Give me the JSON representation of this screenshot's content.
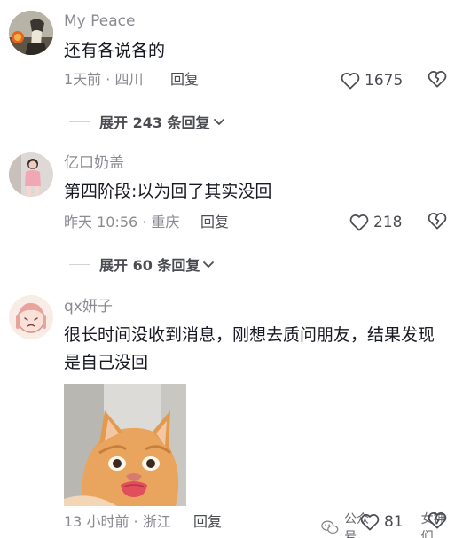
{
  "comments": [
    {
      "username": "My Peace",
      "text": "还有各说各的",
      "meta": "1天前 · 四川",
      "reply_label": "回复",
      "likes": "1675",
      "expand_label": "展开 243 条回复"
    },
    {
      "username": "亿口奶盖",
      "text": "第四阶段:以为回了其实没回",
      "meta": "昨天 10:56 · 重庆",
      "reply_label": "回复",
      "likes": "218",
      "expand_label": "展开 60 条回复"
    },
    {
      "username": "qx妍子",
      "text": "很长时间没收到消息，刚想去质问朋友，结果发现是自己没回",
      "meta": "13 小时前 · 浙江",
      "reply_label": "回复",
      "likes": "81"
    }
  ],
  "watermark": {
    "text_left": "公众号",
    "text_right": "女神们"
  },
  "icons": {
    "like": "heart-outline-icon",
    "dislike": "broken-heart-icon",
    "expand": "chevron-down-icon",
    "watermark": "wechat-icon"
  },
  "colors": {
    "text_primary": "#161823",
    "text_secondary": "#8a8b91",
    "action": "#4b4c52"
  }
}
